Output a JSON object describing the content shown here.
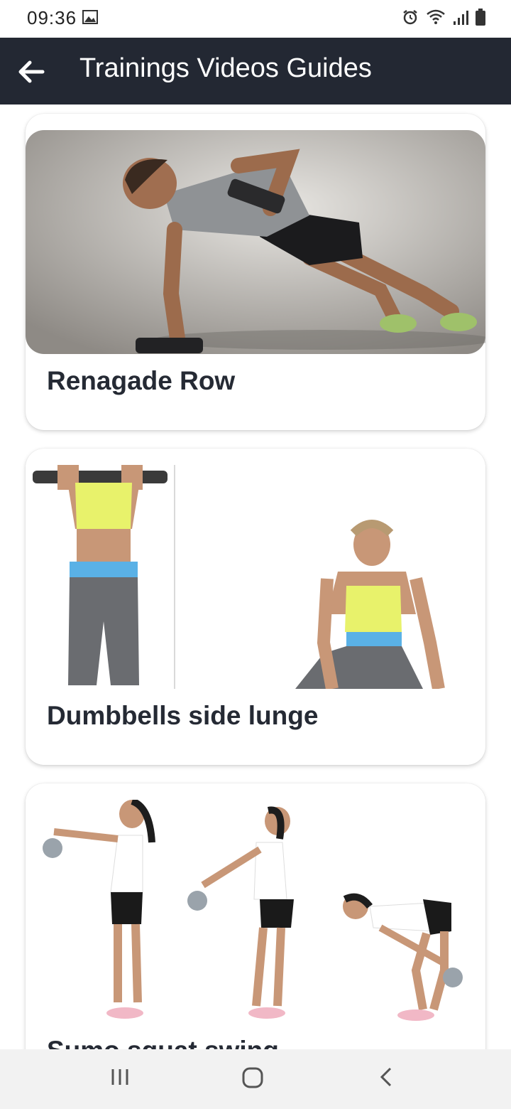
{
  "status_bar": {
    "time": "09:36"
  },
  "app_bar": {
    "title": "Trainings Videos Guides"
  },
  "cards": [
    {
      "title": "Renagade Row",
      "image": "man-renegade-row-photo"
    },
    {
      "title": "Dumbbells side lunge",
      "image": "woman-dumbbell-lunge-photo"
    },
    {
      "title": "Sumo squat swing",
      "image": "woman-kettlebell-swing-photo"
    }
  ],
  "colors": {
    "app_bar": "#232833",
    "title_text": "#252a34",
    "background": "#ffffff"
  }
}
